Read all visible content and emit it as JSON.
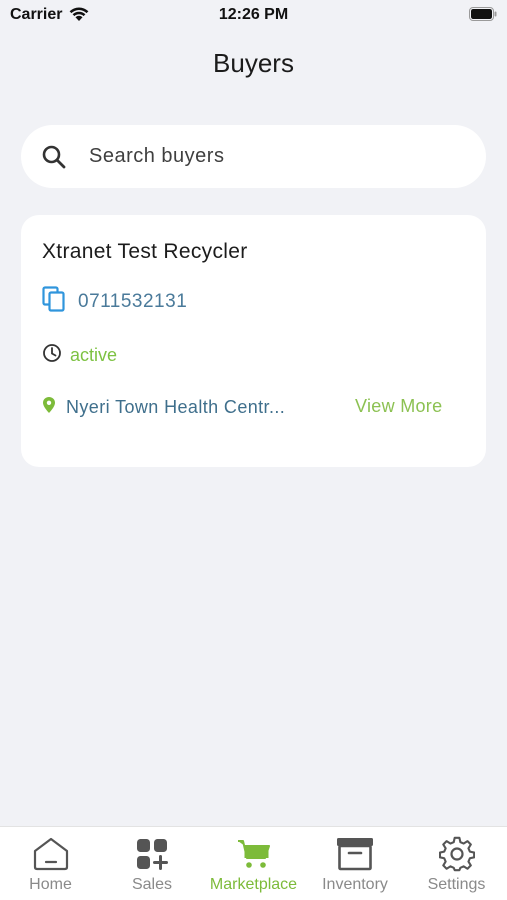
{
  "status_bar": {
    "carrier": "Carrier",
    "time": "12:26 PM"
  },
  "page": {
    "title": "Buyers"
  },
  "search": {
    "placeholder": "Search buyers",
    "value": ""
  },
  "buyers": [
    {
      "name": "Xtranet Test Recycler",
      "phone": "0711532131",
      "status": "active",
      "location": "Nyeri Town Health Centr...",
      "action_label": "View More"
    }
  ],
  "tab_bar": {
    "active": "Marketplace",
    "tabs": [
      {
        "label": "Home",
        "icon": "home-icon"
      },
      {
        "label": "Sales",
        "icon": "grid-plus-icon"
      },
      {
        "label": "Marketplace",
        "icon": "cart-icon"
      },
      {
        "label": "Inventory",
        "icon": "archive-box-icon"
      },
      {
        "label": "Settings",
        "icon": "gear-icon"
      }
    ]
  },
  "colors": {
    "accent_green": "#7dbb3a",
    "phone_blue": "#2f95dc",
    "text_blue_gray": "#3f6f8c",
    "background": "#f1f2f6"
  }
}
